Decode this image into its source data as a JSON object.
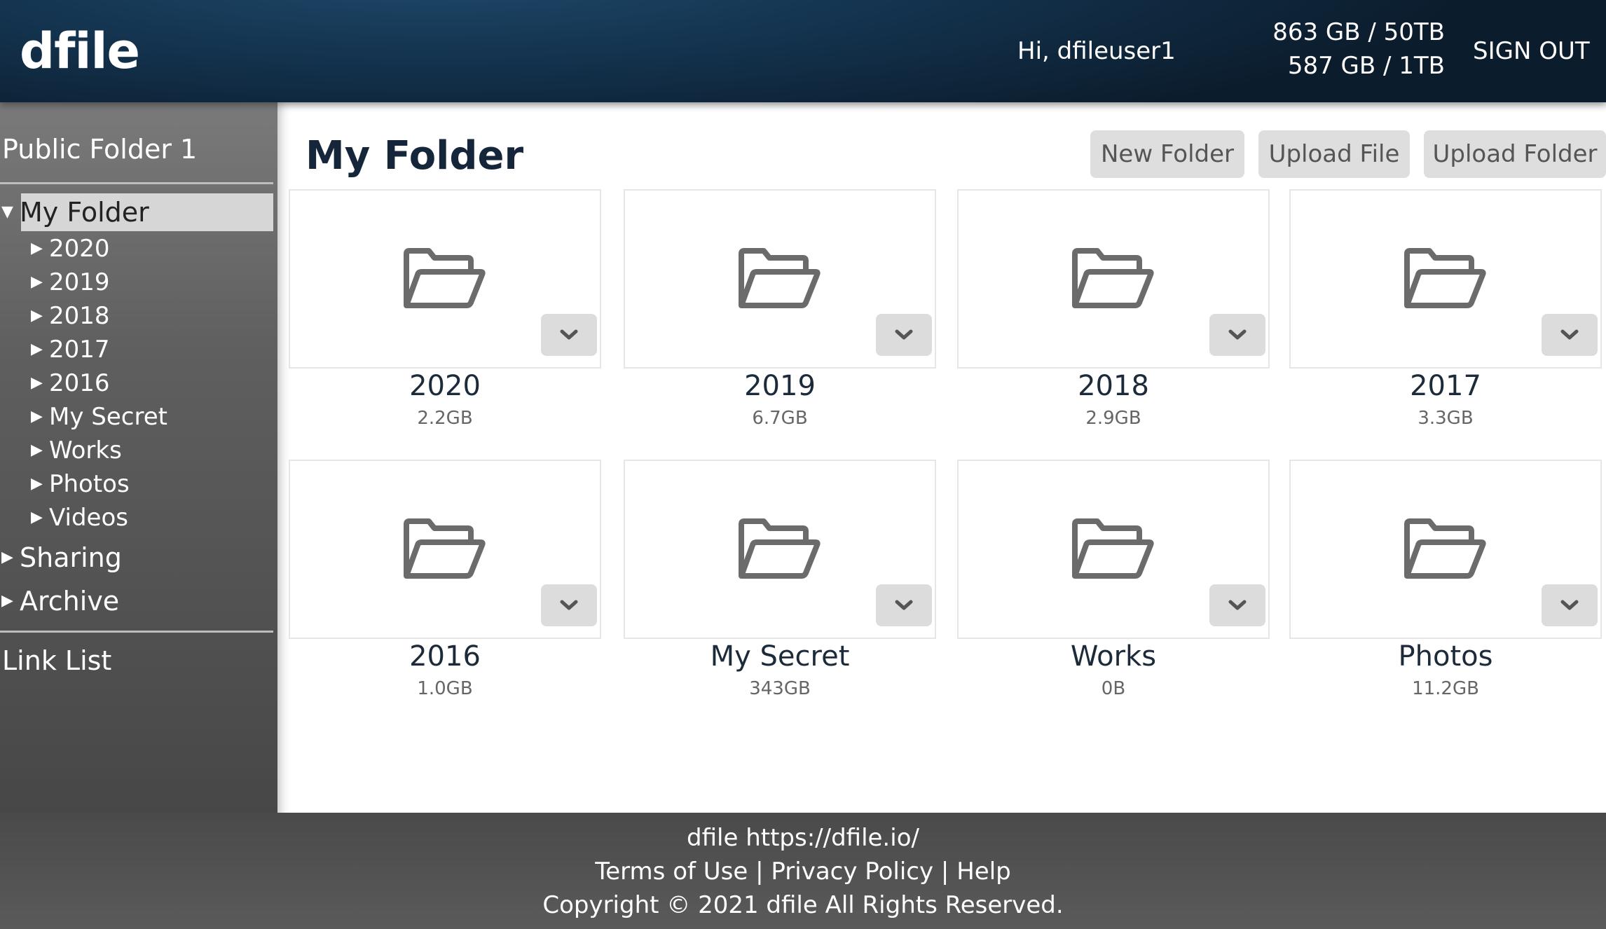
{
  "header": {
    "logo": "dfile",
    "greeting": "Hi, dfileuser1",
    "usage_primary": "863 GB / 50TB",
    "usage_secondary": "587 GB / 1TB",
    "signout": "SIGN OUT"
  },
  "sidebar": {
    "public_folder": "Public Folder 1",
    "my_folder": "My Folder",
    "children": [
      "2020",
      "2019",
      "2018",
      "2017",
      "2016",
      "My Secret",
      "Works",
      "Photos",
      "Videos"
    ],
    "sharing": "Sharing",
    "archive": "Archive",
    "link_list": "Link List"
  },
  "main": {
    "title": "My Folder",
    "buttons": {
      "new_folder": "New Folder",
      "upload_file": "Upload File",
      "upload_folder": "Upload Folder"
    },
    "folders": [
      {
        "name": "2020",
        "size": "2.2GB"
      },
      {
        "name": "2019",
        "size": "6.7GB"
      },
      {
        "name": "2018",
        "size": "2.9GB"
      },
      {
        "name": "2017",
        "size": "3.3GB"
      },
      {
        "name": "2016",
        "size": "1.0GB"
      },
      {
        "name": "My Secret",
        "size": "343GB"
      },
      {
        "name": "Works",
        "size": "0B"
      },
      {
        "name": "Photos",
        "size": "11.2GB"
      }
    ]
  },
  "footer": {
    "brand_line": "dfile https://dfile.io/",
    "terms": "Terms of Use",
    "separator": "|",
    "privacy": "Privacy Policy",
    "help": "Help",
    "copyright": "Copyright © 2021 dfile All Rights Reserved."
  },
  "colors": {
    "header_dark": "#0b1c2c",
    "header_mid": "#143450",
    "sidebar": "#5f5f5f",
    "sidebar_selected": "#d6d6d6",
    "title_text": "#15263a",
    "button_bg": "#dedede",
    "icon_gray": "#6b6b6b",
    "footer": "#505050"
  },
  "icons": {
    "folder": "folder-open-icon",
    "menu": "chevron-down-icon",
    "tree_collapsed": "caret-right-icon",
    "tree_expanded": "caret-down-icon"
  }
}
